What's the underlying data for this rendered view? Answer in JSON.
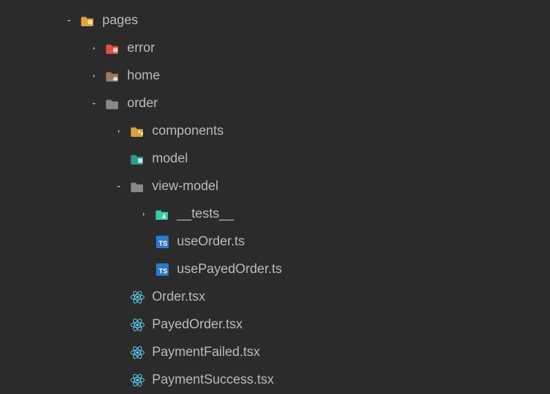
{
  "tree": {
    "pages": {
      "label": "pages",
      "error": {
        "label": "error"
      },
      "home": {
        "label": "home"
      },
      "order": {
        "label": "order",
        "components": {
          "label": "components"
        },
        "model": {
          "label": "model"
        },
        "viewModel": {
          "label": "view-model",
          "tests": {
            "label": "__tests__"
          },
          "useOrder": {
            "label": "useOrder.ts"
          },
          "usePayedOrder": {
            "label": "usePayedOrder.ts"
          }
        },
        "orderTsx": {
          "label": "Order.tsx"
        },
        "payedOrderTsx": {
          "label": "PayedOrder.tsx"
        },
        "paymentFailedTsx": {
          "label": "PaymentFailed.tsx"
        },
        "paymentSuccessTsx": {
          "label": "PaymentSuccess.tsx"
        }
      }
    }
  }
}
